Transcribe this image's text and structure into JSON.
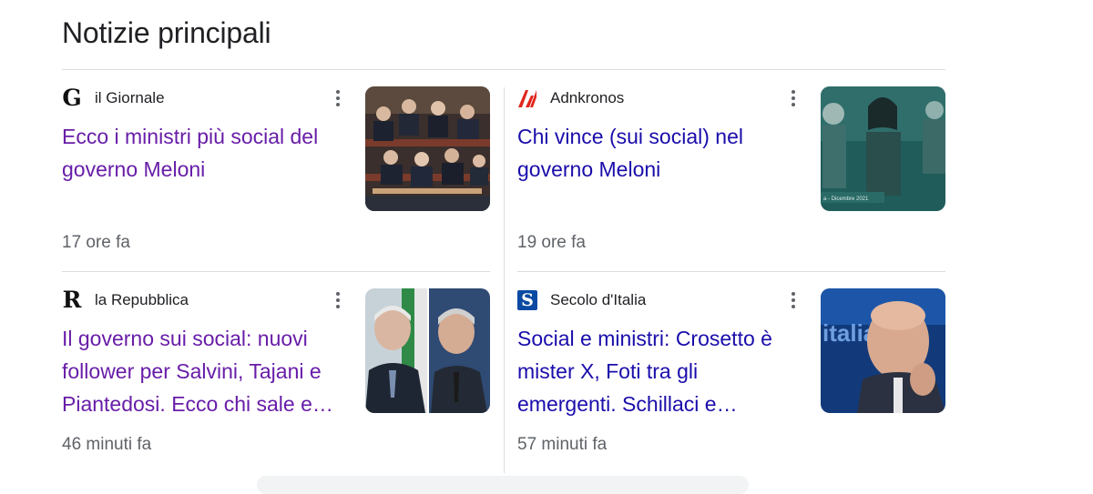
{
  "section": {
    "title": "Notizie principali"
  },
  "colors": {
    "visited": "#681da8",
    "unvisited": "#1a0dab",
    "meta": "#5f6368"
  },
  "cards": [
    {
      "source": "il Giornale",
      "logo_icon": "il-giornale-logo-icon",
      "logo_text": "G",
      "headline": "Ecco i ministri più social del governo Meloni",
      "time": "17 ore fa",
      "visited": true
    },
    {
      "source": "Adnkronos",
      "logo_icon": "adnkronos-logo-icon",
      "headline": "Chi vince (sui social) nel governo Meloni",
      "time": "19 ore fa",
      "visited": false,
      "thumb_caption": "a - Dicembre 2021"
    },
    {
      "source": "la Repubblica",
      "logo_icon": "la-repubblica-logo-icon",
      "logo_text": "R",
      "headline": "Il governo sui social: nuovi follower per Salvini, Tajani e Piantedosi. Ecco chi sale e…",
      "time": "46 minuti fa",
      "visited": true
    },
    {
      "source": "Secolo d'Italia",
      "logo_icon": "secolo-ditalia-logo-icon",
      "logo_text": "S",
      "headline": "Social e ministri: Crosetto è mister X, Foti tra gli emergenti. Schillaci e…",
      "time": "57 minuti fa",
      "visited": false,
      "thumb_caption": "italia"
    }
  ]
}
